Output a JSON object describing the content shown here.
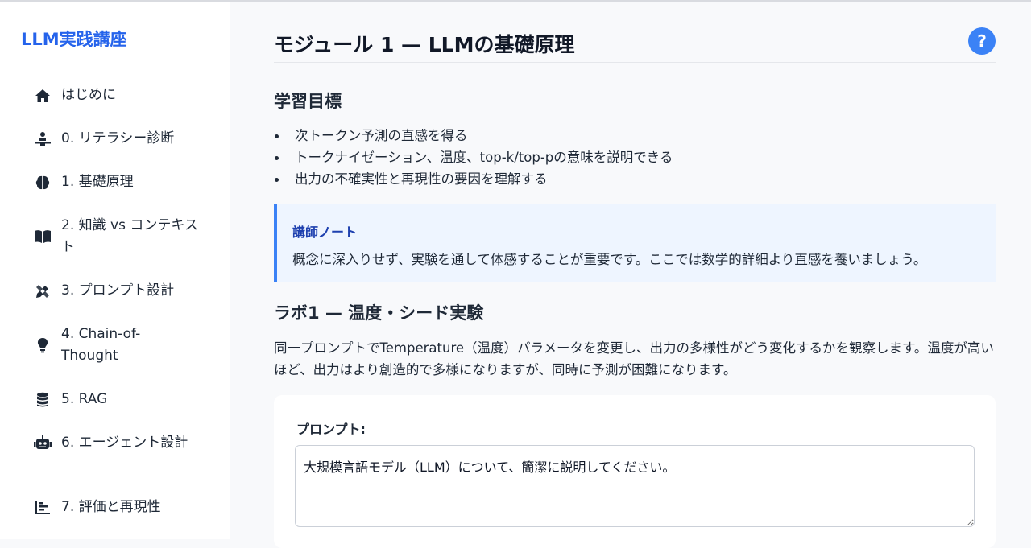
{
  "sidebar": {
    "brand": "LLM実践講座",
    "items": [
      {
        "label": "はじめに",
        "icon": "home-icon"
      },
      {
        "label": "0. リテラシー診断",
        "icon": "person-desk-icon"
      },
      {
        "label": "1. 基礎原理",
        "icon": "brain-icon"
      },
      {
        "label": "2. 知識 vs コンテキスト",
        "icon": "book-icon"
      },
      {
        "label": "3. プロンプト設計",
        "icon": "pen-ruler-icon"
      },
      {
        "label": "4. Chain-of-Thought",
        "icon": "lightbulb-icon"
      },
      {
        "label": "5. RAG",
        "icon": "database-icon"
      },
      {
        "label": "6. エージェント設計",
        "icon": "robot-icon"
      },
      {
        "label": "7. 評価と再現性",
        "icon": "chart-bar-icon"
      }
    ]
  },
  "main": {
    "title": "モジュール 1 — LLMの基礎原理",
    "help_glyph": "?",
    "objectives": {
      "heading": "学習目標",
      "items": [
        "次トークン予測の直感を得る",
        "トークナイゼーション、温度、top-k/top-pの意味を説明できる",
        "出力の不確実性と再現性の要因を理解する"
      ]
    },
    "note": {
      "title": "講師ノート",
      "body": "概念に深入りせず、実験を通して体感することが重要です。ここでは数学的詳細より直感を養いましょう。"
    },
    "lab": {
      "heading": "ラボ1 — 温度・シード実験",
      "description": "同一プロンプトでTemperature（温度）パラメータを変更し、出力の多様性がどう変化するかを観察します。温度が高いほど、出力はより創造的で多様になりますが、同時に予測が困難になります。",
      "prompt_label": "プロンプト:",
      "prompt_value": "大規模言語モデル（LLM）について、簡潔に説明してください。"
    }
  },
  "colors": {
    "accent": "#2563eb",
    "help_button": "#3b82f6",
    "note_bg": "#eef5ff",
    "note_border": "#3b82f6",
    "note_title": "#1e40af"
  }
}
